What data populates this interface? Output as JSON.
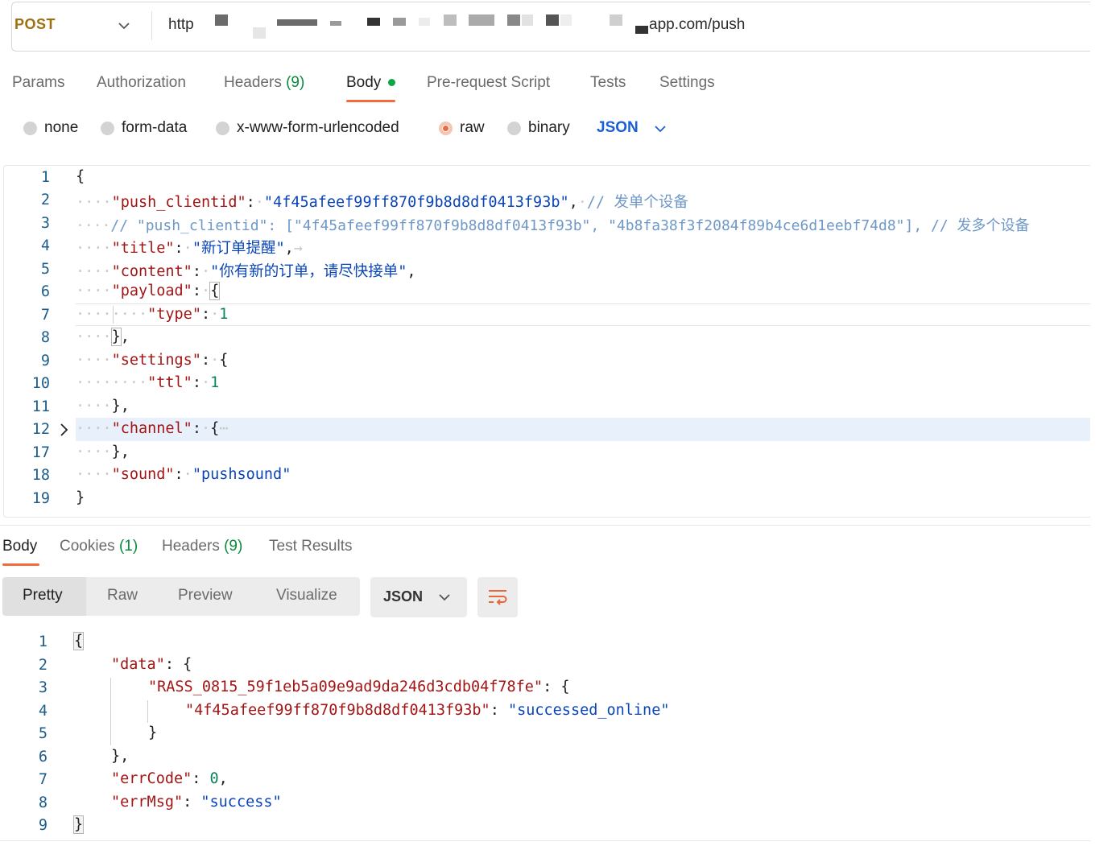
{
  "request": {
    "method": "POST",
    "url_prefix": "http",
    "url_suffix": "app.com/push"
  },
  "request_tabs": [
    {
      "label": "Params"
    },
    {
      "label": "Authorization"
    },
    {
      "label": "Headers",
      "count": "(9)"
    },
    {
      "label": "Body"
    },
    {
      "label": "Pre-request Script"
    },
    {
      "label": "Tests"
    },
    {
      "label": "Settings"
    }
  ],
  "body_types": [
    "none",
    "form-data",
    "x-www-form-urlencoded",
    "raw",
    "binary"
  ],
  "selected_body_type": "raw",
  "body_format": "JSON",
  "request_lines": [
    {
      "n": "1"
    },
    {
      "n": "2"
    },
    {
      "n": "3"
    },
    {
      "n": "4"
    },
    {
      "n": "5"
    },
    {
      "n": "6"
    },
    {
      "n": "7"
    },
    {
      "n": "8"
    },
    {
      "n": "9"
    },
    {
      "n": "10"
    },
    {
      "n": "11"
    },
    {
      "n": "12"
    },
    {
      "n": "17"
    },
    {
      "n": "18"
    },
    {
      "n": "19"
    }
  ],
  "request_code": {
    "l2_key": "\"push_clientid\"",
    "l2_val": "\"4f45afeef99ff870f9b8d8df0413f93b\"",
    "l2_comment": "// 发单个设备",
    "l3_comment": "// \"push_clientid\": [\"4f45afeef99ff870f9b8d8df0413f93b\", \"4b8fa38f3f2084f89b4ce6d1eebf74d8\"], // 发多个设备",
    "l4_key": "\"title\"",
    "l4_val": "\"新订单提醒\"",
    "l5_key": "\"content\"",
    "l5_val": "\"你有新的订单，请尽快接单\"",
    "l6_key": "\"payload\"",
    "l7_key": "\"type\"",
    "l7_val": "1",
    "l9_key": "\"settings\"",
    "l10_key": "\"ttl\"",
    "l10_val": "1",
    "l12_key": "\"channel\"",
    "l18_key": "\"sound\"",
    "l18_val": "\"pushsound\""
  },
  "response_tabs": [
    {
      "label": "Body"
    },
    {
      "label": "Cookies",
      "count": "(1)"
    },
    {
      "label": "Headers",
      "count": "(9)"
    },
    {
      "label": "Test Results"
    }
  ],
  "view_modes": [
    "Pretty",
    "Raw",
    "Preview",
    "Visualize"
  ],
  "response_format": "JSON",
  "response_lines": [
    "1",
    "2",
    "3",
    "4",
    "5",
    "6",
    "7",
    "8",
    "9"
  ],
  "response_code": {
    "data_key": "\"data\"",
    "rass_key": "\"RASS_0815_59f1eb5a09e9ad9da246d3cdb04f78fe\"",
    "client_key": "\"4f45afeef99ff870f9b8d8df0413f93b\"",
    "client_val": "\"successed_online\"",
    "errcode_key": "\"errCode\"",
    "errcode_val": "0",
    "errmsg_key": "\"errMsg\"",
    "errmsg_val": "\"success\""
  },
  "colors": {
    "accent": "#f26b3a",
    "method": "#a07010",
    "json_key": "#a31515",
    "json_string": "#0a45b8",
    "json_number": "#098658",
    "count_green": "#0a8a3a"
  },
  "icons": [
    "chevron-down-icon",
    "fold-arrow-icon",
    "wrap-lines-icon"
  ]
}
